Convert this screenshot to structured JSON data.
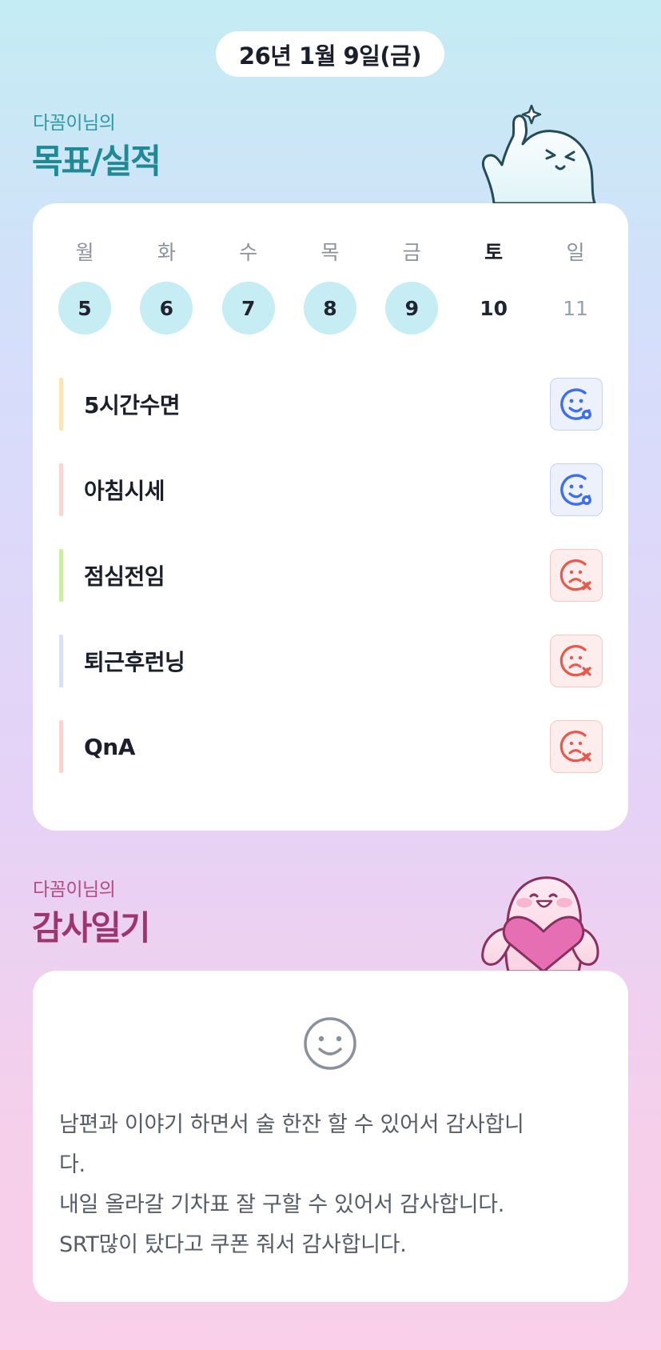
{
  "header": {
    "date": "26년 1월 9일(금)"
  },
  "goals_section": {
    "owner": "다꼼이님의",
    "title": "목표/실적"
  },
  "week": [
    {
      "dow": "월",
      "num": "5",
      "state": "done"
    },
    {
      "dow": "화",
      "num": "6",
      "state": "done"
    },
    {
      "dow": "수",
      "num": "7",
      "state": "done"
    },
    {
      "dow": "목",
      "num": "8",
      "state": "done"
    },
    {
      "dow": "금",
      "num": "9",
      "state": "done"
    },
    {
      "dow": "토",
      "num": "10",
      "state": "today"
    },
    {
      "dow": "일",
      "num": "11",
      "state": "future"
    }
  ],
  "goals": [
    {
      "name": "5시간수면",
      "color": "#fde3b8",
      "status": "success",
      "icon": "smile-check-icon"
    },
    {
      "name": "아침시세",
      "color": "#fbd6cf",
      "status": "success",
      "icon": "smile-check-icon"
    },
    {
      "name": "점심전임",
      "color": "#c9eea4",
      "status": "fail",
      "icon": "sad-x-icon"
    },
    {
      "name": "퇴근후런닝",
      "color": "#d7e1f8",
      "status": "fail",
      "icon": "sad-x-icon"
    },
    {
      "name": "QnA",
      "color": "#fcd2cd",
      "status": "fail",
      "icon": "sad-x-icon"
    }
  ],
  "diary_section": {
    "owner": "다꼼이님의",
    "title": "감사일기"
  },
  "diary": {
    "mood_icon": "smile-icon",
    "lines": [
      "남편과 이야기 하면서 술 한잔 할 수 있어서 감사합니",
      "다.",
      "내일 올라갈 기차표 잘 구할 수 있어서 감사합니다.",
      "SRT많이 탔다고 쿠폰 줘서 감사합니다."
    ]
  },
  "colors": {
    "success_icon": "#3d6ef0",
    "fail_icon": "#e8584c",
    "teal_title": "#1f8a94",
    "pink_title": "#9d3670",
    "done_circle": "#c6edf3"
  }
}
